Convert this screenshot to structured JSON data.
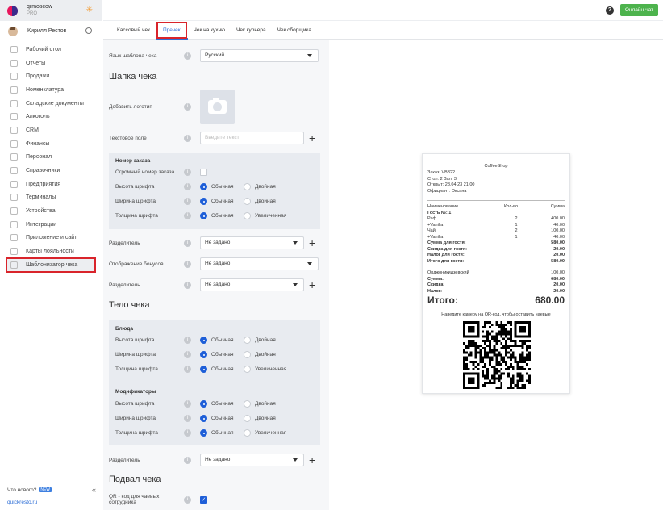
{
  "brand": {
    "name": "qrmoscow",
    "plan": "PRO"
  },
  "user": {
    "name": "Кирилл Рестов"
  },
  "nav": [
    {
      "label": "Рабочий стол"
    },
    {
      "label": "Отчеты"
    },
    {
      "label": "Продажи"
    },
    {
      "label": "Номенклатура"
    },
    {
      "label": "Складские документы"
    },
    {
      "label": "Алкоголь"
    },
    {
      "label": "CRM"
    },
    {
      "label": "Финансы"
    },
    {
      "label": "Персонал"
    },
    {
      "label": "Справочники"
    },
    {
      "label": "Предприятия"
    },
    {
      "label": "Терминалы"
    },
    {
      "label": "Устройства"
    },
    {
      "label": "Интеграции"
    },
    {
      "label": "Приложение и сайт"
    },
    {
      "label": "Карты лояльности"
    },
    {
      "label": "Шаблонизатор чека"
    }
  ],
  "footer": {
    "whats_new": "Что нового?",
    "new_badge": "NEW",
    "site": "quickresto.ru"
  },
  "topbar": {
    "help": "?",
    "chat": "Онлайн-чат"
  },
  "tabs": [
    "Кассовый чек",
    "Пречек",
    "Чек на кухню",
    "Чек курьера",
    "Чек сборщика"
  ],
  "form": {
    "language_label": "Язык шаблона чека",
    "language_value": "Русский",
    "header_title": "Шапка чека",
    "logo_label": "Добавить логотип",
    "text_field_label": "Текстовое поле",
    "text_field_placeholder": "Введите текст",
    "order_group": "Номер заказа",
    "big_number_label": "Огромный номер заказа",
    "font_height": "Высота шрифта",
    "font_width": "Ширина шрифта",
    "font_weight": "Толщина шрифта",
    "normal": "Обычная",
    "double": "Двойная",
    "increased": "Увеличенная",
    "separator_label": "Разделитель",
    "not_set": "Не задано",
    "bonus_label": "Отображение бонусов",
    "body_title": "Тело чека",
    "dishes_group": "Блюда",
    "modifiers_group": "Модификаторы",
    "footer_title": "Подвал чека",
    "qr_label": "QR - код для чаевых сотрудника",
    "info": "i",
    "plus": "+",
    "check": "✓"
  },
  "receipt": {
    "shop": "CoffeeShop",
    "order": "Заказ: VB322",
    "table": "Стол: 2 Зал: 3",
    "opened": "Открыт: 28.04.23 21:00",
    "waiter": "Официант: Оксана",
    "col_name": "Наименование",
    "col_qty": "Кол-во",
    "col_sum": "Сумма",
    "guest": "Гость №: 1",
    "items": [
      {
        "name": "Раф",
        "qty": "2",
        "sum": "400.00"
      },
      {
        "name": "+Vanilla",
        "qty": "1",
        "sum": "40.00"
      },
      {
        "name": "Чай",
        "qty": "2",
        "sum": "100.00"
      },
      {
        "name": "+Vanilla",
        "qty": "1",
        "sum": "40.00"
      }
    ],
    "guest_totals": [
      {
        "label": "Сумма для гостя:",
        "value": "580.00"
      },
      {
        "label": "Скидка для гостя:",
        "value": "20.00"
      },
      {
        "label": "Налог для гостя:",
        "value": "20.00"
      },
      {
        "label": "Итого для гостя:",
        "value": "580.00"
      }
    ],
    "guest_name": "Орджоникидзевский",
    "guest_name_value": "100.00",
    "totals": [
      {
        "label": "Сумма:",
        "value": "680.00"
      },
      {
        "label": "Скидка:",
        "value": "20.00"
      },
      {
        "label": "Налог:",
        "value": "20.00"
      }
    ],
    "grand_label": "Итого:",
    "grand_value": "680.00",
    "qr_hint": "Наведите камеру на QR-код, чтобы оставить чаевые"
  }
}
